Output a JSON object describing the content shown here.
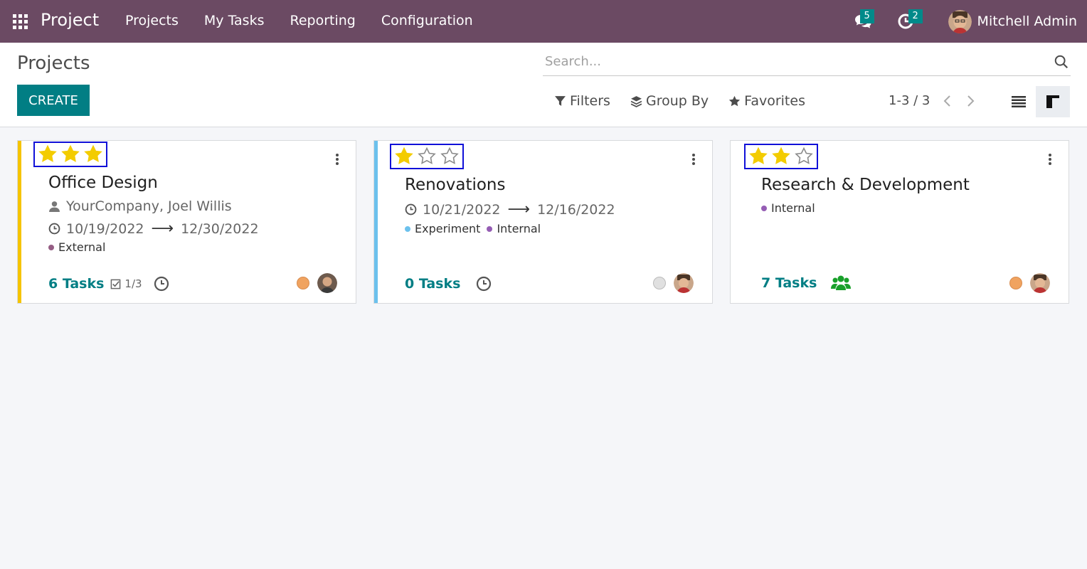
{
  "navbar": {
    "app_name": "Project",
    "menu": [
      "Projects",
      "My Tasks",
      "Reporting",
      "Configuration"
    ],
    "messages_count": "5",
    "activities_count": "2",
    "user_name": "Mitchell Admin",
    "bg_color": "#6b4a63"
  },
  "control_panel": {
    "title": "Projects",
    "create_label": "CREATE",
    "search_placeholder": "Search...",
    "filters_label": "Filters",
    "group_by_label": "Group By",
    "favorites_label": "Favorites",
    "pager_value": "1-3 / 3"
  },
  "projects": [
    {
      "name": "Office Design",
      "priority": 3,
      "color": "#f5c400",
      "customer": "YourCompany, Joel Willis",
      "date_start": "10/19/2022",
      "date_end": "12/30/2022",
      "tags": [
        {
          "name": "External",
          "color": "#955d84"
        }
      ],
      "tasks_label": "6 Tasks",
      "milestones": "1/3",
      "status_color": "#f0a360"
    },
    {
      "name": "Renovations",
      "priority": 1,
      "color": "#6cc1ed",
      "date_start": "10/21/2022",
      "date_end": "12/16/2022",
      "tags": [
        {
          "name": "Experiment",
          "color": "#6cc1ed"
        },
        {
          "name": "Internal",
          "color": "#955db4"
        }
      ],
      "tasks_label": "0 Tasks",
      "status_color": "#e0e0e0"
    },
    {
      "name": "Research & Development",
      "priority": 2,
      "color": "#ffffff",
      "tags": [
        {
          "name": "Internal",
          "color": "#955db4"
        }
      ],
      "tasks_label": "7 Tasks",
      "status_color": "#f0a360"
    }
  ],
  "colors": {
    "accent": "#017e84",
    "star_on": "#f3cc00",
    "star_off": "#8a8a8a",
    "highlight_box": "#1010d8"
  }
}
